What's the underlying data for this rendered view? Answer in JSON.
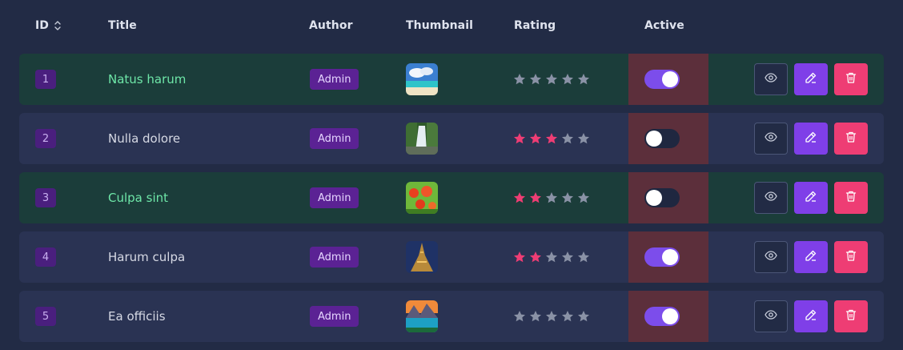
{
  "header": {
    "id": "ID",
    "title": "Title",
    "author": "Author",
    "thumbnail": "Thumbnail",
    "rating": "Rating",
    "active": "Active"
  },
  "colors": {
    "star_filled": "#ee3d74",
    "star_empty": "#8a92a6",
    "row_highlight": "#1b3d3a",
    "row_default": "#2a3353",
    "active_cell": "#5c2f3b",
    "toggle_on": "#7c4deb"
  },
  "rows": [
    {
      "id": "1",
      "title": "Natus harum",
      "author": "Admin",
      "thumbnail": "beach-thumbnail",
      "rating": 0,
      "active": true,
      "highlighted": true
    },
    {
      "id": "2",
      "title": "Nulla dolore",
      "author": "Admin",
      "thumbnail": "waterfall-thumbnail",
      "rating": 3,
      "active": false,
      "highlighted": false
    },
    {
      "id": "3",
      "title": "Culpa sint",
      "author": "Admin",
      "thumbnail": "poppies-thumbnail",
      "rating": 2,
      "active": false,
      "highlighted": true
    },
    {
      "id": "4",
      "title": "Harum culpa",
      "author": "Admin",
      "thumbnail": "eiffel-tower-thumbnail",
      "rating": 2,
      "active": true,
      "highlighted": false
    },
    {
      "id": "5",
      "title": "Ea officiis",
      "author": "Admin",
      "thumbnail": "mountain-lake-thumbnail",
      "rating": 0,
      "active": true,
      "highlighted": false
    }
  ]
}
